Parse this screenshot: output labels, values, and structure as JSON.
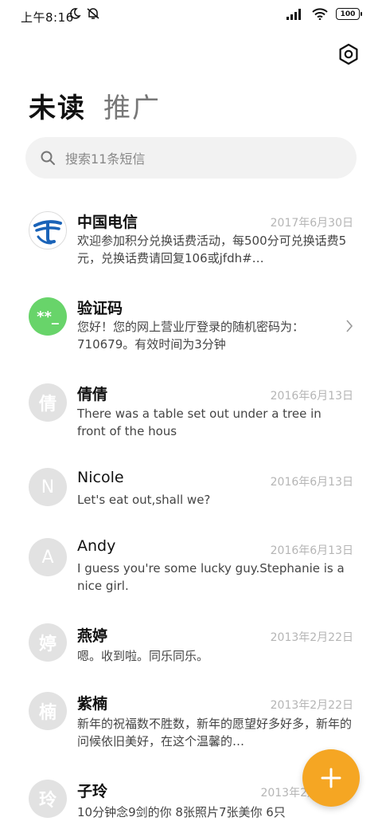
{
  "status_bar": {
    "time": "上午8:16",
    "battery": "100"
  },
  "header": {
    "tab_active": "未读",
    "tab_inactive": "推广"
  },
  "search": {
    "placeholder": "搜索11条短信"
  },
  "messages": [
    {
      "name": "中国电信",
      "date": "2017年6月30日",
      "preview": "欢迎参加积分兑换话费活动，每500分可兑换话费5元，兑换话费请回复106或jfdh#…",
      "avatar": "telecom-logo"
    },
    {
      "name": "验证码",
      "date": "",
      "preview": "您好！您的网上营业厅登录的随机密码为：710679。有效时间为3分钟",
      "avatar_text": "**_"
    },
    {
      "name": "倩倩",
      "date": "2016年6月13日",
      "preview": "There was a table set out under a tree in front of the hous",
      "avatar_text": "倩"
    },
    {
      "name": "Nicole",
      "date": "2016年6月13日",
      "preview": "Let's eat out,shall we?",
      "avatar_text": "N"
    },
    {
      "name": "Andy",
      "date": "2016年6月13日",
      "preview": "I guess you're some lucky guy.Stephanie is a nice girl.",
      "avatar_text": "A"
    },
    {
      "name": "燕婷",
      "date": "2013年2月22日",
      "preview": "嗯。收到啦。同乐同乐。",
      "avatar_text": "婷"
    },
    {
      "name": "紫楠",
      "date": "2013年2月22日",
      "preview": "新年的祝福数不胜数，新年的愿望好多好多，新年的问候依旧美好，在这个温馨的…",
      "avatar_text": "楠"
    },
    {
      "name": "子玲",
      "date": "2013年2月",
      "preview": "10分钟念9剑的你  8张照片7张美你  6只",
      "avatar_text": "玲"
    }
  ],
  "colors": {
    "accent": "#f5a623",
    "verify_green": "#68d46a",
    "telecom_blue": "#1a63b8"
  }
}
